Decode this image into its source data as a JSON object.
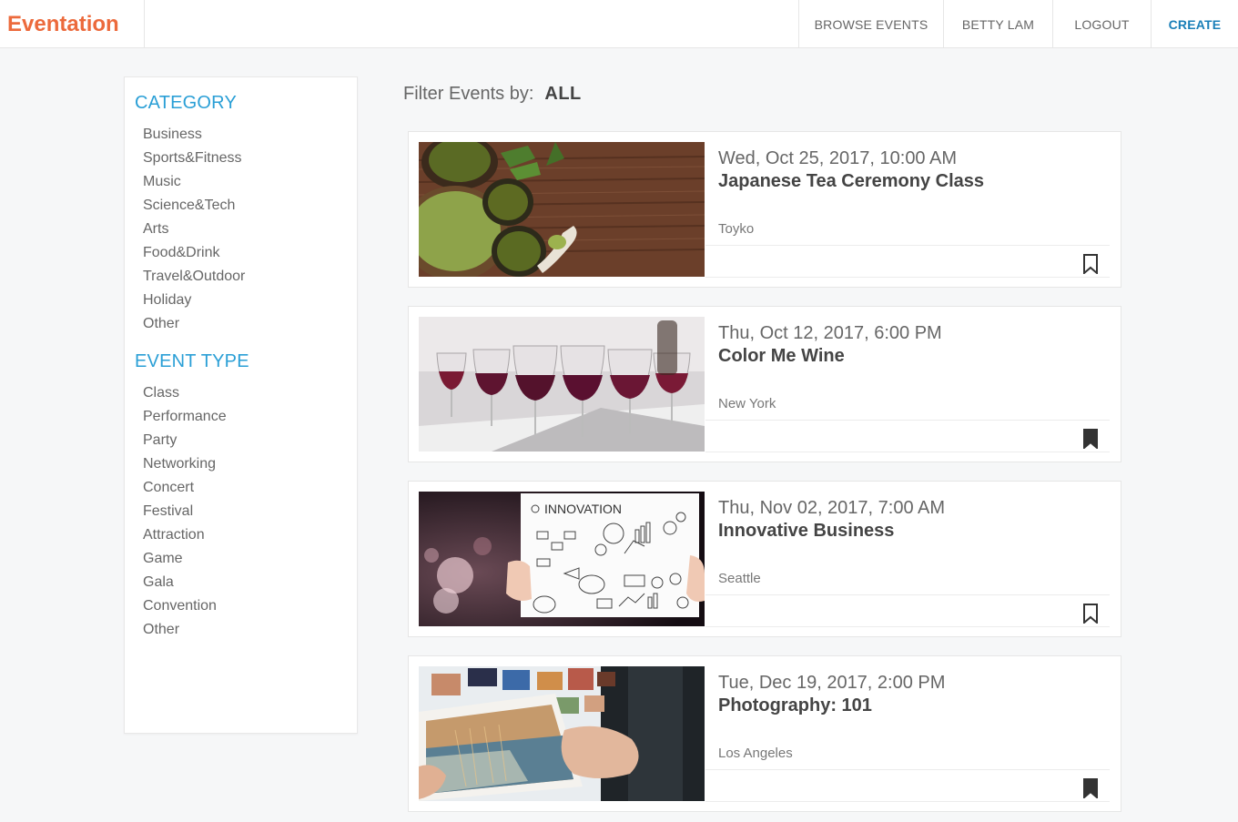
{
  "nav": {
    "brand": "Eventation",
    "browse": "BROWSE EVENTS",
    "user": "BETTY LAM",
    "logout": "LOGOUT",
    "create": "CREATE"
  },
  "sidebar": {
    "category_heading": "CATEGORY",
    "categories": [
      "Business",
      "Sports&Fitness",
      "Music",
      "Science&Tech",
      "Arts",
      "Food&Drink",
      "Travel&Outdoor",
      "Holiday",
      "Other"
    ],
    "event_type_heading": "EVENT TYPE",
    "event_types": [
      "Class",
      "Performance",
      "Party",
      "Networking",
      "Concert",
      "Festival",
      "Attraction",
      "Game",
      "Gala",
      "Convention",
      "Other"
    ]
  },
  "filter": {
    "label": "Filter Events by:",
    "value": "ALL"
  },
  "events": [
    {
      "date": "Wed, Oct 25, 2017, 10:00 AM",
      "title": "Japanese Tea Ceremony Class",
      "location": "Toyko",
      "bookmarked": false,
      "image": "matcha tea bowls on wooden table"
    },
    {
      "date": "Thu, Oct 12, 2017, 6:00 PM",
      "title": "Color Me Wine",
      "location": "New York",
      "bookmarked": true,
      "image": "red wine glasses"
    },
    {
      "date": "Thu, Nov 02, 2017, 7:00 AM",
      "title": "Innovative Business",
      "location": "Seattle",
      "bookmarked": false,
      "image": "innovation sketch board"
    },
    {
      "date": "Tue, Dec 19, 2017, 2:00 PM",
      "title": "Photography: 101",
      "location": "Los Angeles",
      "bookmarked": true,
      "image": "hands holding landscape photo print"
    }
  ],
  "thumb_text": {
    "innovation": "INNOVATION"
  },
  "colors": {
    "brand": "#ec6a3c",
    "accent": "#2a9fd6",
    "create": "#1a7fb8"
  }
}
